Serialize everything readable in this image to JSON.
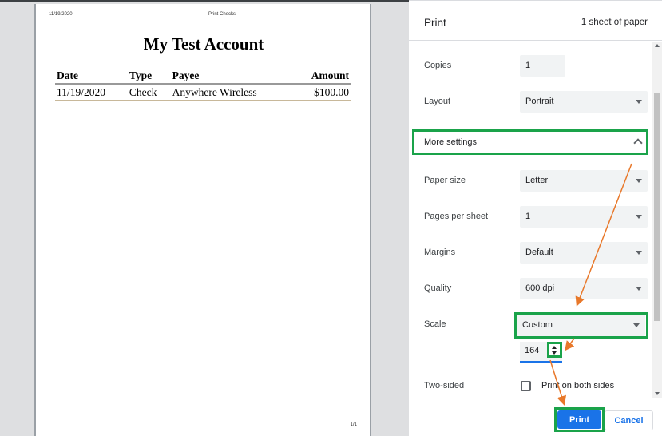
{
  "preview": {
    "header_date": "11/19/2020",
    "header_title": "Print Checks",
    "doc_title": "My Test Account",
    "columns": [
      "Date",
      "Type",
      "Payee",
      "Amount"
    ],
    "rows": [
      [
        "11/19/2020",
        "Check",
        "Anywhere Wireless",
        "$100.00"
      ]
    ],
    "page_number": "1/1"
  },
  "panel": {
    "title": "Print",
    "sheet_count": "1 sheet of paper",
    "copies": {
      "label": "Copies",
      "value": "1"
    },
    "layout": {
      "label": "Layout",
      "value": "Portrait"
    },
    "more_settings": "More settings",
    "paper_size": {
      "label": "Paper size",
      "value": "Letter"
    },
    "pages_per_sheet": {
      "label": "Pages per sheet",
      "value": "1"
    },
    "margins": {
      "label": "Margins",
      "value": "Default"
    },
    "quality": {
      "label": "Quality",
      "value": "600 dpi"
    },
    "scale": {
      "label": "Scale",
      "value": "Custom",
      "custom_value": "164"
    },
    "two_sided": {
      "label": "Two-sided",
      "option": "Print on both sides",
      "checked": false
    }
  },
  "footer": {
    "print_label": "Print",
    "cancel_label": "Cancel"
  },
  "colors": {
    "accent": "#1a73e8",
    "highlight": "#1aa34a",
    "arrow": "#e8782a"
  }
}
